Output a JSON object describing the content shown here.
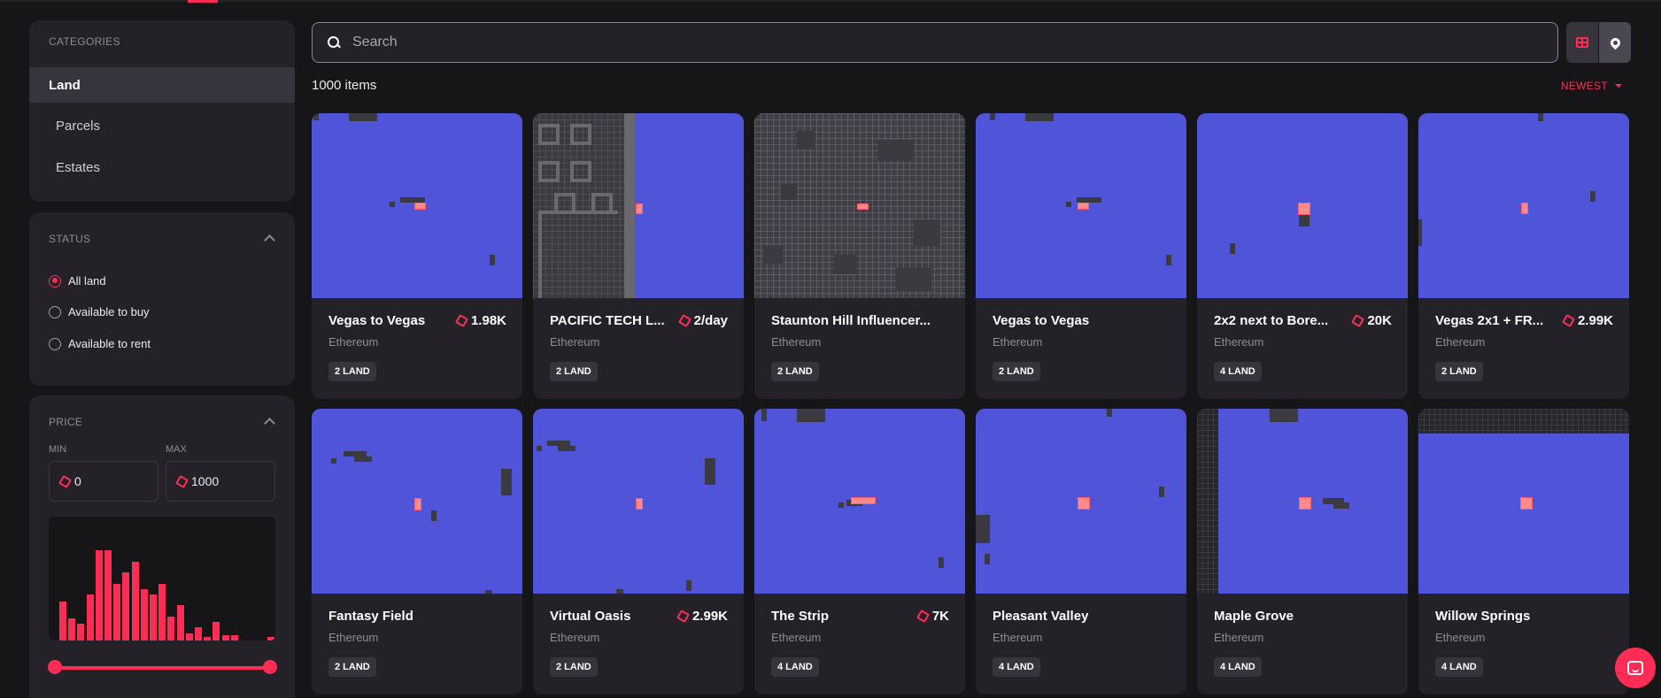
{
  "categories": {
    "title": "CATEGORIES",
    "items": [
      {
        "label": "Land",
        "active": true
      },
      {
        "label": "Parcels",
        "active": false
      },
      {
        "label": "Estates",
        "active": false
      }
    ]
  },
  "status": {
    "title": "STATUS",
    "options": [
      {
        "label": "All land",
        "selected": true
      },
      {
        "label": "Available to buy",
        "selected": false
      },
      {
        "label": "Available to rent",
        "selected": false
      }
    ]
  },
  "price": {
    "title": "PRICE",
    "min_label": "MIN",
    "max_label": "MAX",
    "min_value": "0",
    "max_value": "1000",
    "histogram": [
      0.42,
      0.24,
      0.18,
      0.5,
      0.98,
      0.98,
      0.62,
      0.74,
      0.86,
      0.56,
      0.5,
      0.62,
      0.26,
      0.38,
      0.08,
      0.14,
      0.04,
      0.2,
      0.06,
      0.06,
      0,
      0,
      0,
      0.04
    ]
  },
  "search": {
    "placeholder": "Search"
  },
  "results": {
    "count": "1000 items",
    "sort": "NEWEST"
  },
  "colors": {
    "accent": "#ff2d55",
    "map": "#5054d8",
    "panel": "#242129",
    "background": "#161518"
  },
  "cards": [
    {
      "name": "Vegas to Vegas",
      "price": "1.98K",
      "network": "Ethereum",
      "badge": "2 LAND"
    },
    {
      "name": "PACIFIC TECH L...",
      "price": "2/day",
      "network": "Ethereum",
      "badge": "2 LAND"
    },
    {
      "name": "Staunton Hill Influencer...",
      "price": "",
      "network": "Ethereum",
      "badge": "2 LAND"
    },
    {
      "name": "Vegas to Vegas",
      "price": "",
      "network": "Ethereum",
      "badge": "2 LAND"
    },
    {
      "name": "2x2 next to Bore...",
      "price": "20K",
      "network": "Ethereum",
      "badge": "4 LAND"
    },
    {
      "name": "Vegas 2x1 + FR...",
      "price": "2.99K",
      "network": "Ethereum",
      "badge": "2 LAND"
    },
    {
      "name": "Fantasy Field",
      "price": "",
      "network": "Ethereum",
      "badge": "2 LAND"
    },
    {
      "name": "Virtual Oasis",
      "price": "2.99K",
      "network": "Ethereum",
      "badge": "2 LAND"
    },
    {
      "name": "The Strip",
      "price": "7K",
      "network": "Ethereum",
      "badge": "4 LAND"
    },
    {
      "name": "Pleasant Valley",
      "price": "",
      "network": "Ethereum",
      "badge": "4 LAND"
    },
    {
      "name": "Maple Grove",
      "price": "",
      "network": "Ethereum",
      "badge": "4 LAND"
    },
    {
      "name": "Willow Springs",
      "price": "",
      "network": "Ethereum",
      "badge": "4 LAND"
    }
  ]
}
